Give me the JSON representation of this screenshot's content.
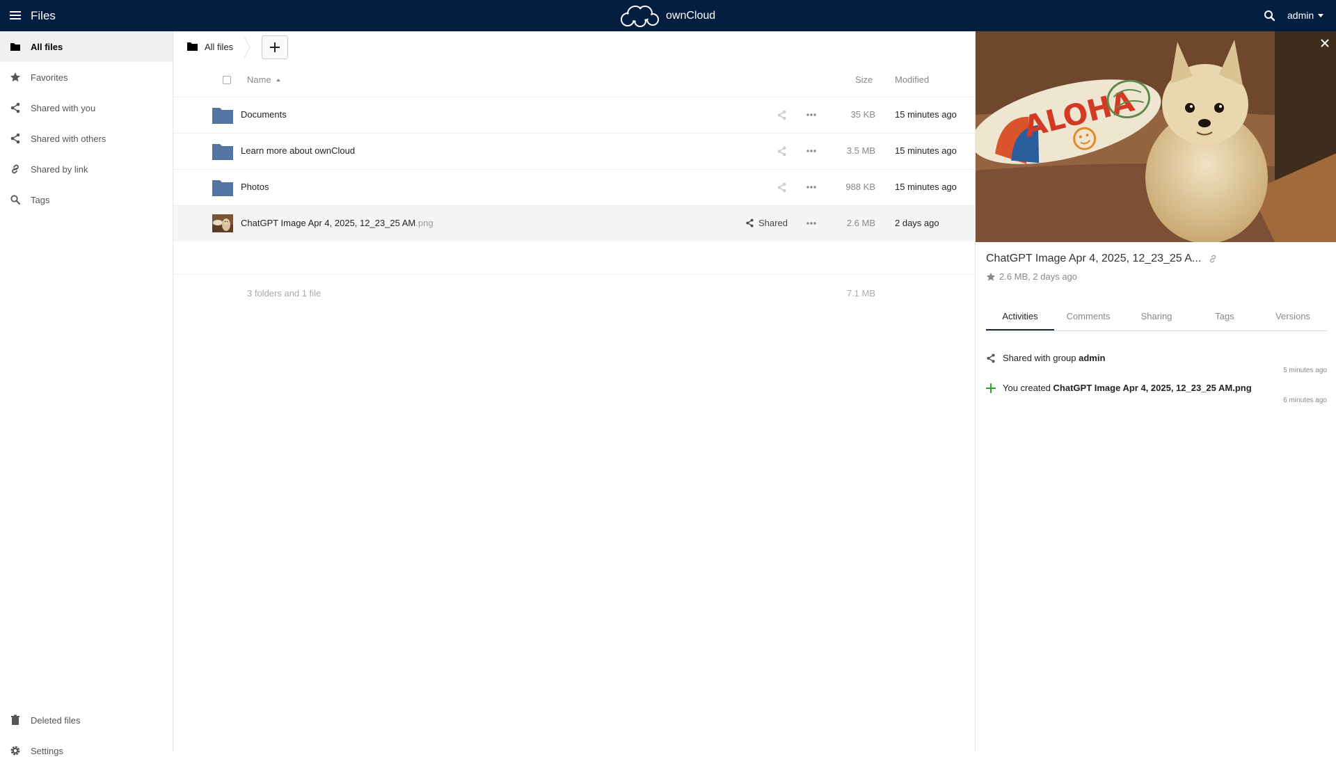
{
  "header": {
    "app_name": "Files",
    "logo_text": "ownCloud",
    "user": "admin",
    "brand_color": "#041e42"
  },
  "sidebar": {
    "items": [
      {
        "label": "All files",
        "icon": "folder-icon",
        "active": true
      },
      {
        "label": "Favorites",
        "icon": "star-icon"
      },
      {
        "label": "Shared with you",
        "icon": "share-icon"
      },
      {
        "label": "Shared with others",
        "icon": "share-icon"
      },
      {
        "label": "Shared by link",
        "icon": "link-icon"
      },
      {
        "label": "Tags",
        "icon": "search-icon"
      }
    ],
    "bottom": [
      {
        "label": "Deleted files",
        "icon": "trash-icon"
      },
      {
        "label": "Settings",
        "icon": "gear-icon"
      }
    ]
  },
  "breadcrumb": {
    "home": "All files",
    "new_label": "+"
  },
  "table": {
    "columns": {
      "name": "Name",
      "size": "Size",
      "modified": "Modified"
    },
    "rows": [
      {
        "name": "Documents",
        "ext": "",
        "type": "folder",
        "size": "35 KB",
        "modified": "15 minutes ago",
        "shared": ""
      },
      {
        "name": "Learn more about ownCloud",
        "ext": "",
        "type": "folder",
        "size": "3.5 MB",
        "modified": "15 minutes ago",
        "shared": ""
      },
      {
        "name": "Photos",
        "ext": "",
        "type": "folder",
        "size": "988 KB",
        "modified": "15 minutes ago",
        "shared": ""
      },
      {
        "name": "ChatGPT Image Apr 4, 2025, 12_23_25 AM",
        "ext": ".png",
        "type": "image",
        "size": "2.6 MB",
        "modified": "2 days ago",
        "shared": "Shared"
      }
    ],
    "summary_text": "3 folders and 1 file",
    "summary_size": "7.1 MB"
  },
  "details": {
    "title": "ChatGPT Image Apr 4, 2025, 12_23_25 A...",
    "meta": "2.6 MB, 2 days ago",
    "tabs": [
      "Activities",
      "Comments",
      "Sharing",
      "Tags",
      "Versions"
    ],
    "active_tab": "Activities",
    "activities": [
      {
        "prefix": "Shared with group ",
        "bold": "admin",
        "time": "5 minutes ago",
        "icon": "share-icon"
      },
      {
        "prefix": "You created ",
        "bold": "ChatGPT Image Apr 4, 2025, 12_23_25 AM.png",
        "time": "6 minutes ago",
        "icon": "plus-icon"
      }
    ],
    "preview_text": "ALOHA"
  },
  "colors": {
    "folder": "#5474a3",
    "accent_green": "#2ba32b",
    "selected_row": "#f5f5f5"
  }
}
